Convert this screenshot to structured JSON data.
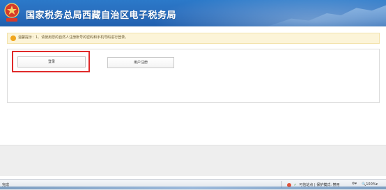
{
  "header": {
    "title": "国家税务总局西藏自治区电子税务局",
    "emblem_icon": "tax-emblem-icon"
  },
  "notice": {
    "text": "温馨提示：1、请使用您的自然人注册账号的密码和手机号码进行登录。",
    "icon": "warning-icon"
  },
  "panel": {
    "login_label": "登录",
    "register_label": "用户注册"
  },
  "statusbar": {
    "ready": "完成",
    "zone": "可信站点 | 保护模式: 禁用",
    "zoom": "100%"
  },
  "colors": {
    "header_blue": "#2a6fbf",
    "notice_bg": "#fcf4d8",
    "highlight_red": "#e02a2a"
  }
}
